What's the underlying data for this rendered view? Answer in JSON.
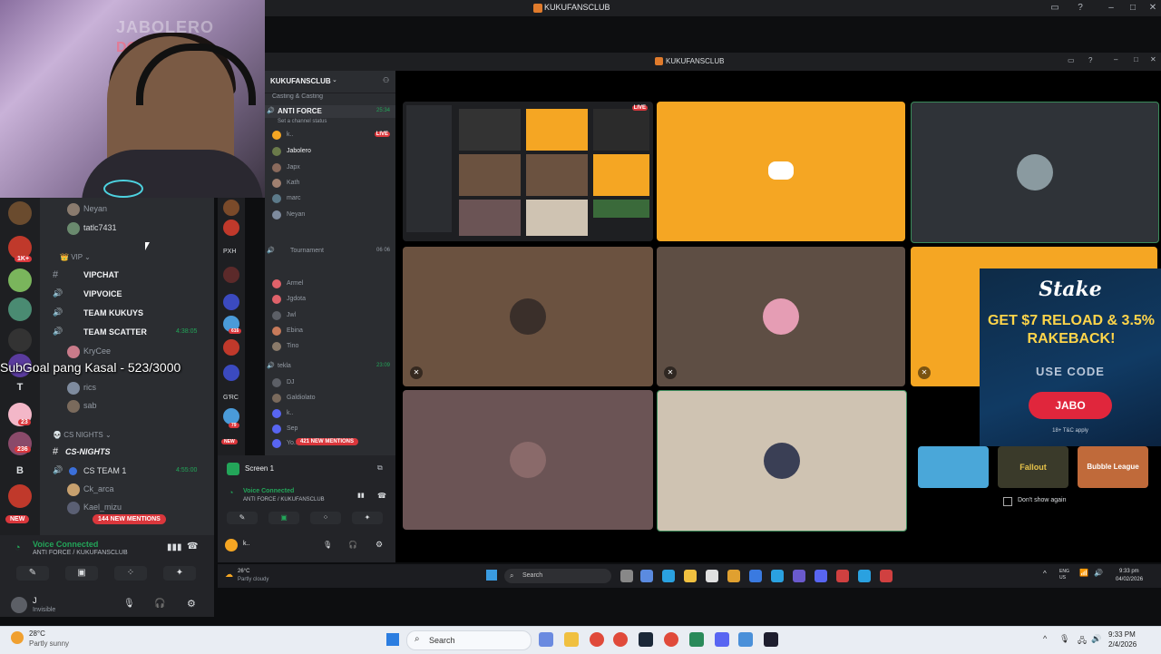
{
  "window": {
    "title": "KUKUFANSCLUB"
  },
  "webcam": {
    "overlay_line1": "JABOLERO",
    "overlay_line2": "DOTA"
  },
  "overlay": {
    "subgoal": "SubGoal pang Kasal - 523/3000"
  },
  "left_rail": {
    "badges": [
      "1K+",
      "23",
      "236"
    ],
    "letters": [
      "T",
      "B"
    ],
    "new_label": "NEW"
  },
  "left_channels": {
    "rows_top": [
      {
        "label": "Neyan"
      },
      {
        "label": "tatlc7431"
      }
    ],
    "vip_category": "VIP",
    "channels": [
      {
        "label": "VIPCHAT"
      },
      {
        "label": "VIPVOICE"
      },
      {
        "label": "TEAM KUKUYS"
      },
      {
        "label": "TEAM SCATTER",
        "time": "4:38:05"
      }
    ],
    "scatter_users": [
      "KryCee",
      "rics",
      "sab"
    ],
    "cs_category": "CS NIGHTS",
    "cs_channel": "CS-NIGHTS",
    "cs_team": {
      "label": "CS TEAM 1",
      "time": "4:55:00"
    },
    "cs_users": [
      "Ck_arca",
      "Kael_mizu"
    ],
    "new_mentions": "144 NEW MENTIONS"
  },
  "left_voice": {
    "status": "Voice Connected",
    "channel": "ANTI FORCE / KUKUFANSCLUB",
    "user": "J",
    "user_status": "Invisible"
  },
  "inner_window": {
    "title": "KUKUFANSCLUB",
    "server": "KUKUFANSCLUB",
    "section": "Casting & Casting",
    "channel": "ANTI FORCE",
    "channel_sub": "Set a channel status",
    "channel_time": "25:34",
    "members": [
      "k..",
      "Jabolero",
      "Japx",
      "Kath",
      "marc",
      "Neyan"
    ],
    "tournament": "Tournament",
    "tournament_counts": "06 06",
    "tournament_members": [
      "Armel",
      "Jgdota",
      "Jwl",
      "Ebina",
      "Tino"
    ],
    "tekla": "tekla",
    "tekla_time": "23:09",
    "tekla_members": [
      "DJ",
      "Galdiolato",
      "k..",
      "Sep",
      "Yo.."
    ],
    "new_mentions": "421 NEW MENTIONS",
    "screen": "Screen 1",
    "voice_status": "Voice Connected",
    "voice_channel": "ANTI FORCE / KUKUFANSCLUB",
    "rail_labels": [
      "PXH",
      "G'RC"
    ],
    "rail_badges": [
      "616",
      "79"
    ],
    "new_label": "NEW"
  },
  "stage": {
    "live_label": "LIVE"
  },
  "ad": {
    "brand": "Stake",
    "headline": "GET $7 RELOAD & 3.5% RAKEBACK!",
    "code_label": "USE CODE",
    "code": "JABO",
    "tc": "18+ T&C apply"
  },
  "games": [
    "Fallout",
    "Bubble League"
  ],
  "dont_show": "Don't show again",
  "inner_taskbar": {
    "weather_temp": "26°C",
    "weather_desc": "Partly cloudy",
    "search": "Search",
    "lang": "ENG US",
    "time": "9:33 pm",
    "date": "04/02/2026"
  },
  "taskbar": {
    "weather_temp": "28°C",
    "weather_desc": "Partly sunny",
    "search": "Search",
    "time": "9:33 PM",
    "date": "2/4/2026"
  },
  "colors": {
    "discord_yellow": "#f5a623",
    "discord_dark": "#2b2d31",
    "voice_green": "#23a559",
    "alert_red": "#da373c"
  }
}
